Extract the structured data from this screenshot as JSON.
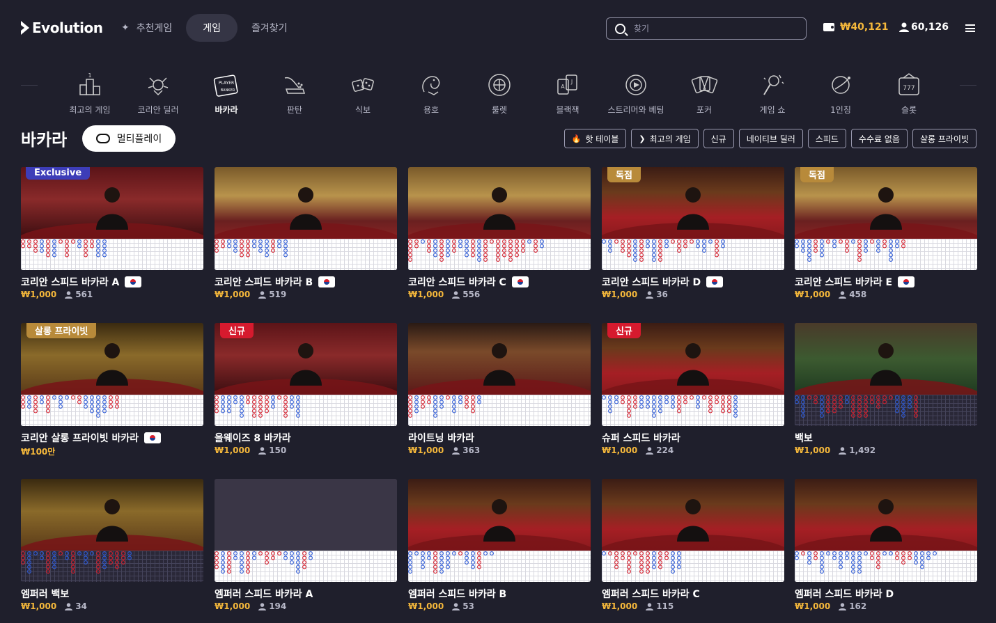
{
  "brand": {
    "logo": "Evolution"
  },
  "nav": {
    "items": [
      {
        "label": "추천게임"
      },
      {
        "label": "게임"
      },
      {
        "label": "즐겨찾기"
      }
    ]
  },
  "search": {
    "placeholder": "찾기"
  },
  "header": {
    "balance": "₩40,121",
    "players": "60,126"
  },
  "categories": [
    {
      "label": "최고의 게임",
      "icon": "podium-icon"
    },
    {
      "label": "코리안 딜러",
      "icon": "korean-dealer-icon"
    },
    {
      "label": "바카라",
      "icon": "baccarat-icon",
      "active": true
    },
    {
      "label": "판탄",
      "icon": "fan-tan-icon"
    },
    {
      "label": "식보",
      "icon": "dice-icon"
    },
    {
      "label": "용호",
      "icon": "dragon-tiger-icon"
    },
    {
      "label": "룰렛",
      "icon": "roulette-icon"
    },
    {
      "label": "블랙잭",
      "icon": "blackjack-icon"
    },
    {
      "label": "스트리머와 베팅",
      "icon": "streamer-icon"
    },
    {
      "label": "포커",
      "icon": "poker-icon"
    },
    {
      "label": "게임 쇼",
      "icon": "game-show-icon"
    },
    {
      "label": "1인칭",
      "icon": "first-person-icon"
    },
    {
      "label": "슬롯",
      "icon": "slot-icon"
    }
  ],
  "section": {
    "title": "바카라",
    "multiplay_label": "멀티플레이"
  },
  "filters": [
    {
      "label": "핫 테이블",
      "icon": "fire-icon"
    },
    {
      "label": "최고의 게임",
      "icon": "evolution-icon"
    },
    {
      "label": "신규"
    },
    {
      "label": "네이티브 딜러"
    },
    {
      "label": "스피드"
    },
    {
      "label": "수수료 없음"
    },
    {
      "label": "살롱 프라이빗"
    }
  ],
  "games": [
    {
      "title": "코리안 스피드 바카라 A",
      "flag": true,
      "bet": "₩1,000",
      "players": "561",
      "badge": "Exclusive",
      "badge_color": "blue",
      "scene": "red",
      "road": "light"
    },
    {
      "title": "코리안 스피드 바카라 B",
      "flag": true,
      "bet": "₩1,000",
      "players": "519",
      "badge": "",
      "scene": "gold",
      "road": "light"
    },
    {
      "title": "코리안 스피드 바카라 C",
      "flag": true,
      "bet": "₩1,000",
      "players": "556",
      "badge": "",
      "scene": "gold",
      "road": "light"
    },
    {
      "title": "코리안 스피드 바카라 D",
      "flag": true,
      "bet": "₩1,000",
      "players": "36",
      "badge": "독점",
      "badge_color": "gold",
      "scene": "redtable",
      "road": "light"
    },
    {
      "title": "코리안 스피드 바카라 E",
      "flag": true,
      "bet": "₩1,000",
      "players": "458",
      "badge": "독점",
      "badge_color": "gold",
      "scene": "gold",
      "road": "light"
    },
    {
      "title": "코리안 살롱 프라이빗 바카라",
      "flag": true,
      "bet": "₩100만",
      "players": "",
      "badge": "살롱 프라이빗",
      "badge_color": "gold",
      "scene": "darkgold",
      "road": "light"
    },
    {
      "title": "올웨이즈 8 바카라",
      "flag": false,
      "bet": "₩1,000",
      "players": "150",
      "badge": "신규",
      "badge_color": "red",
      "scene": "red",
      "road": "light"
    },
    {
      "title": "라이트닝 바카라",
      "flag": false,
      "bet": "₩1,000",
      "players": "363",
      "badge": "",
      "scene": "lightning",
      "road": "light"
    },
    {
      "title": "슈퍼 스피드 바카라",
      "flag": false,
      "bet": "₩1,000",
      "players": "224",
      "badge": "신규",
      "badge_color": "red",
      "scene": "redtable",
      "road": "light"
    },
    {
      "title": "백보",
      "flag": false,
      "bet": "₩1,000",
      "players": "1,492",
      "badge": "",
      "scene": "green",
      "road": "dark"
    },
    {
      "title": "엠퍼러 백보",
      "flag": false,
      "bet": "₩1,000",
      "players": "34",
      "badge": "",
      "scene": "darkgold",
      "road": "dark"
    },
    {
      "title": "엠퍼러 스피드 바카라 A",
      "flag": false,
      "bet": "₩1,000",
      "players": "194",
      "badge": "",
      "scene": "empty",
      "road": "light"
    },
    {
      "title": "엠퍼러 스피드 바카라 B",
      "flag": false,
      "bet": "₩1,000",
      "players": "53",
      "badge": "",
      "scene": "redtable",
      "road": "light"
    },
    {
      "title": "엠퍼러 스피드 바카라 C",
      "flag": false,
      "bet": "₩1,000",
      "players": "115",
      "badge": "",
      "scene": "redtable",
      "road": "light"
    },
    {
      "title": "엠퍼러 스피드 바카라 D",
      "flag": false,
      "bet": "₩1,000",
      "players": "162",
      "badge": "",
      "scene": "redtable",
      "road": "light"
    }
  ],
  "colors": {
    "background": "#1f1f2c",
    "accent_gold": "#f5b83b",
    "badge_blue": "#3d3db8",
    "badge_red": "#d61a2e",
    "badge_gold": "#b88a3a"
  }
}
